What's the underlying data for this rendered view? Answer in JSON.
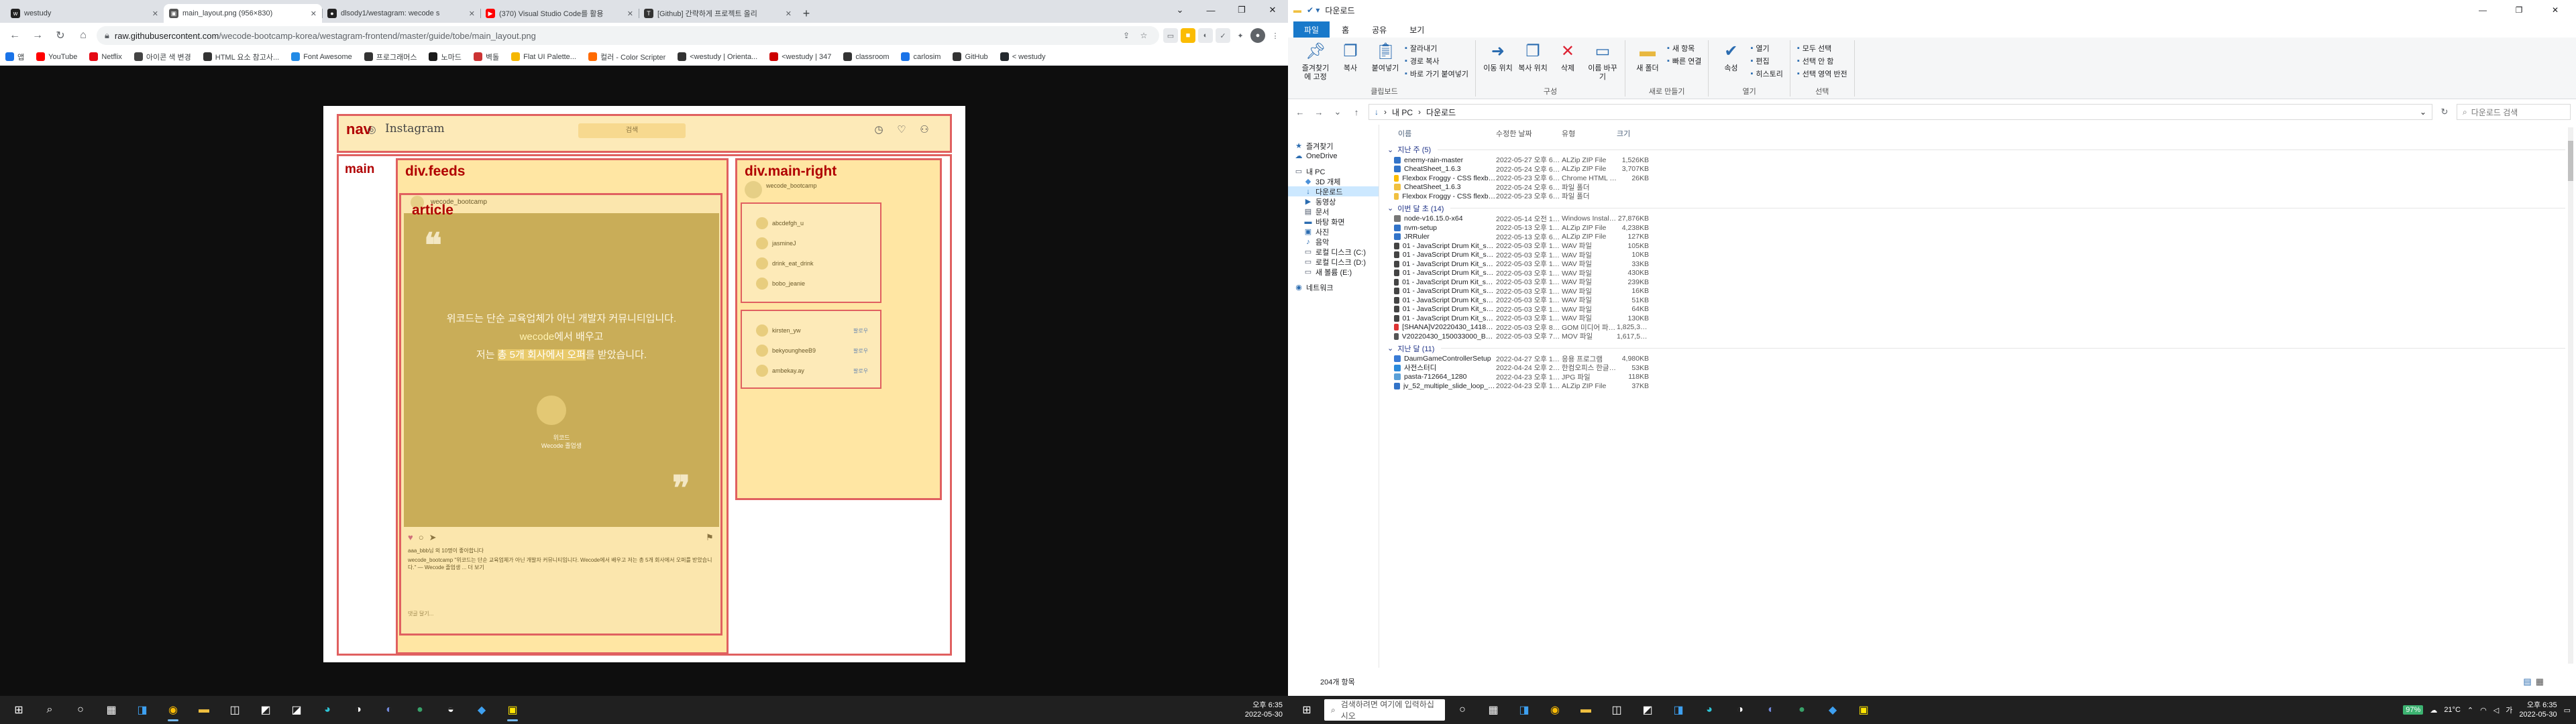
{
  "chrome": {
    "tabs": [
      {
        "title": "westudy",
        "fav_color": "#222"
      },
      {
        "title": "main_layout.png (956×830)",
        "fav_color": "#555"
      },
      {
        "title": "dlsody1/westagram: wecode s",
        "fav_color": "#222"
      },
      {
        "title": "(370) Visual Studio Code를 활용",
        "fav_color": "#ff0000"
      },
      {
        "title": "[Github] 간략하게 프로젝트 올리",
        "fav_color": "#333"
      }
    ],
    "url_prefix": "raw.githubusercontent.com",
    "url_path": "/wecode-bootcamp-korea/westagram-frontend/master/guide/tobe/main_layout.png",
    "bookmarks": [
      "앱",
      "YouTube",
      "Netflix",
      "아이콘 색 변경",
      "HTML 요소 참고사...",
      "Font Awesome",
      "프로그래머스",
      "노마드",
      "벽돌",
      "Flat UI Palette...",
      "컬러 - Color Scripter",
      "<westudy | Orienta...",
      "<westudy | 347",
      "classroom",
      "carlosim",
      "GitHub",
      "< westudy"
    ],
    "bookmark_colors": [
      "#1a73e8",
      "#ff0000",
      "#e50914",
      "#444",
      "#333",
      "#228ae6",
      "#333",
      "#1a1a1a",
      "#c33",
      "#f5b700",
      "#ff6a00",
      "#333",
      "#c00",
      "#333",
      "#1a73e8",
      "#333",
      "#24292e",
      "#333"
    ]
  },
  "image": {
    "labels": {
      "nav": "nav",
      "main": "main",
      "feeds": "div.feeds",
      "article": "article",
      "right": "div.main-right"
    },
    "logo_text": "Instagram",
    "search": "검색",
    "quote_line1": "위코드는 단순 교육업체가 아닌 개발자 커뮤니티입니다.",
    "quote_line2_brand": "wecode",
    "quote_line2_rest": "에서 배우고",
    "quote_line3_pre": "저는 ",
    "quote_line3_hl": "총 5개 회사에서 오퍼",
    "quote_line3_post": "를 받았습니다.",
    "quote_caption1": "위코드",
    "quote_caption2": "Wecode 졸업생",
    "feed_user": "wecode_bootcamp",
    "profile_user": "wecode_bootcamp",
    "story_users": [
      "abcdefgh_u",
      "jasmineJ",
      "drink_eat_drink",
      "bobo_jeanie"
    ],
    "recommend_users": [
      "kirsten_yw",
      "bekyoungheeB9",
      "ambekay.ay"
    ],
    "follow_label": "팔로우",
    "like_text": "aaa_bbb님 외 10명이 좋아합니다",
    "caption_text": "wecode_bootcamp \"위코드는 단순 교육업체가 아닌 개발자 커뮤니티입니다. Wecode에서 배우고 저는 총 5개 회사에서 오퍼를 받았습니다.\" — Wecode 졸업생 ... 더 보기",
    "comment_placeholder": "댓글 달기..."
  },
  "taskbar_left": {
    "time": "오후 6:35",
    "date": "2022-05-30"
  },
  "explorer": {
    "title": "다운로드",
    "tabs": [
      "파일",
      "홈",
      "공유",
      "보기"
    ],
    "groups": [
      {
        "name": "클립보드",
        "big": [
          "즐겨찾기에 고정",
          "복사",
          "붙여넣기"
        ],
        "small": [
          "잘라내기",
          "경로 복사",
          "바로 가기 붙여넣기"
        ]
      },
      {
        "name": "구성",
        "big": [
          "이동 위치",
          "복사 위치",
          "삭제",
          "이름 바꾸기"
        ],
        "small": []
      },
      {
        "name": "새로 만들기",
        "big": [
          "새 폴더"
        ],
        "small": [
          "새 항목",
          "빠른 연결"
        ]
      },
      {
        "name": "열기",
        "big": [
          "속성"
        ],
        "small": [
          "열기",
          "편집",
          "히스토리"
        ]
      },
      {
        "name": "선택",
        "big": [],
        "small": [
          "모두 선택",
          "선택 안 함",
          "선택 영역 반전"
        ]
      }
    ],
    "path": [
      "내 PC",
      "다운로드"
    ],
    "search_placeholder": "다운로드 검색",
    "nav": [
      {
        "label": "즐겨찾기",
        "icon": "★"
      },
      {
        "label": "OneDrive",
        "icon": "☁"
      },
      {
        "label": "내 PC",
        "icon": "▭"
      },
      {
        "label": "3D 개체",
        "icon": "◆"
      },
      {
        "label": "다운로드",
        "icon": "↓"
      },
      {
        "label": "동영상",
        "icon": "▶"
      },
      {
        "label": "문서",
        "icon": "▤"
      },
      {
        "label": "바탕 화면",
        "icon": "▬"
      },
      {
        "label": "사진",
        "icon": "▣"
      },
      {
        "label": "음악",
        "icon": "♪"
      },
      {
        "label": "로컬 디스크 (C:)",
        "icon": "▭"
      },
      {
        "label": "로컬 디스크 (D:)",
        "icon": "▭"
      },
      {
        "label": "새 볼륨 (E:)",
        "icon": "▭"
      },
      {
        "label": "네트워크",
        "icon": "◉"
      }
    ],
    "columns": [
      "이름",
      "수정한 날짜",
      "유형",
      "크기"
    ],
    "groups_files": [
      {
        "title": "지난 주 (5)",
        "rows": [
          [
            "enemy-rain-master",
            "2022-05-27 오후 6:24",
            "ALZip ZIP File",
            "1,526KB",
            "zip"
          ],
          [
            "CheatSheet_1.6.3",
            "2022-05-24 오후 6:25",
            "ALZip ZIP File",
            "3,707KB",
            "zip"
          ],
          [
            "Flexbox Froggy - CSS flexbox 속성 배우...",
            "2022-05-23 오후 6:48",
            "Chrome HTML Do...",
            "26KB",
            "html"
          ],
          [
            "CheatSheet_1.6.3",
            "2022-05-24 오후 6:25",
            "파일 폴더",
            "",
            "folder"
          ],
          [
            "Flexbox Froggy - CSS flexbox 속성 배우...",
            "2022-05-23 오후 6:48",
            "파일 폴더",
            "",
            "folder"
          ]
        ]
      },
      {
        "title": "이번 달 초 (14)",
        "rows": [
          [
            "node-v16.15.0-x64",
            "2022-05-14 오전 12:03",
            "Windows Installer...",
            "27,876KB",
            "msi"
          ],
          [
            "nvm-setup",
            "2022-05-13 오후 11:41",
            "ALZip ZIP File",
            "4,238KB",
            "zip"
          ],
          [
            "JRRuler",
            "2022-05-13 오후 6:59",
            "ALZip ZIP File",
            "127KB",
            "zip"
          ],
          [
            "01 - JavaScript Drum Kit_sounds_tom",
            "2022-05-03 오후 11:52",
            "WAV 파일",
            "105KB",
            "wav"
          ],
          [
            "01 - JavaScript Drum Kit_sounds_tink",
            "2022-05-03 오후 11:52",
            "WAV 파일",
            "10KB",
            "wav"
          ],
          [
            "01 - JavaScript Drum Kit_sounds_snare",
            "2022-05-03 오후 11:52",
            "WAV 파일",
            "33KB",
            "wav"
          ],
          [
            "01 - JavaScript Drum Kit_sounds_ride",
            "2022-05-03 오후 11:52",
            "WAV 파일",
            "430KB",
            "wav"
          ],
          [
            "01 - JavaScript Drum Kit_sounds_openhat",
            "2022-05-03 오후 11:52",
            "WAV 파일",
            "239KB",
            "wav"
          ],
          [
            "01 - JavaScript Drum Kit_sounds_kick",
            "2022-05-03 오후 11:51",
            "WAV 파일",
            "16KB",
            "wav"
          ],
          [
            "01 - JavaScript Drum Kit_sounds_hihat",
            "2022-05-03 오후 11:51",
            "WAV 파일",
            "51KB",
            "wav"
          ],
          [
            "01 - JavaScript Drum Kit_sounds_clap",
            "2022-05-03 오후 11:52",
            "WAV 파일",
            "64KB",
            "wav"
          ],
          [
            "01 - JavaScript Drum Kit_sounds_boom",
            "2022-05-03 오후 11:51",
            "WAV 파일",
            "130KB",
            "wav"
          ],
          [
            "[SHANA]V20220430_141813000_5A8D...",
            "2022-05-03 오후 8:19",
            "GOM 미디어 파일...",
            "1,825,352KB",
            "gom"
          ],
          [
            "V20220430_150033000_BB6520A2-9119-...",
            "2022-05-03 오후 7:56",
            "MOV 파일",
            "1,617,538KB",
            "mov"
          ]
        ]
      },
      {
        "title": "지난 달 (11)",
        "rows": [
          [
            "DaumGameControllerSetup",
            "2022-04-27 오후 11:02",
            "응용 프로그램",
            "4,980KB",
            "exe"
          ],
          [
            "사전스터디",
            "2022-04-24 오후 2:32",
            "한컴오피스 한글 2...",
            "53KB",
            "hwp"
          ],
          [
            "pasta-712664_1280",
            "2022-04-23 오후 1:43",
            "JPG 파일",
            "118KB",
            "jpg"
          ],
          [
            "jv_52_multiple_slide_loop_BASE",
            "2022-04-23 오후 12:20",
            "ALZip ZIP File",
            "37KB",
            "zip"
          ]
        ]
      }
    ],
    "status": "204개 항목"
  },
  "taskbar_right": {
    "search_placeholder": "검색하려면 여기에 입력하십시오",
    "battery": "97%",
    "weather": "21°C",
    "time": "오후 6:35",
    "date": "2022-05-30"
  }
}
